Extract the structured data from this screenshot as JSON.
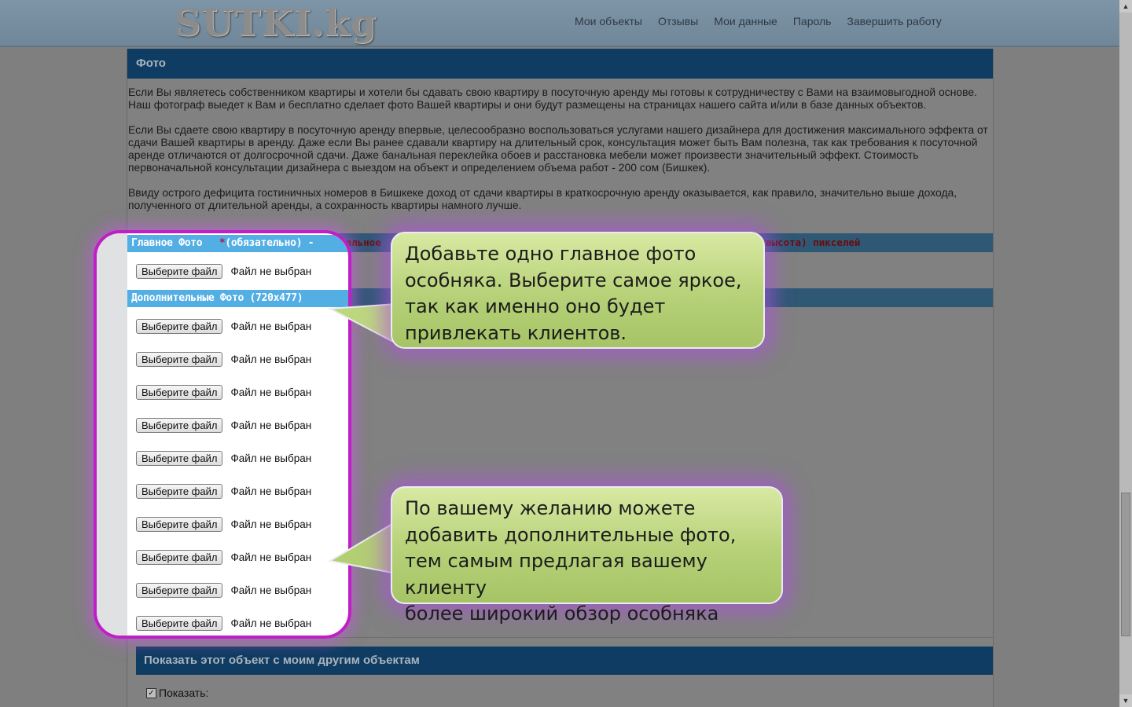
{
  "site": {
    "logo": "SUTKI.kg"
  },
  "nav": [
    "Мои объекты",
    "Отзывы",
    "Мои данные",
    "Пароль",
    "Завершить работу"
  ],
  "section": {
    "title": "Фото",
    "paragraphs": [
      "Если Вы являетесь собственником квартиры и хотели бы сдавать свою квартиру в посуточную аренду мы готовы к сотрудничеству с Вами на взаимовыгодной основе. Наш фотограф выедет к Вам и бесплатно сделает фото Вашей квартиры и они будут размещены на страницах нашего сайта и/или в базе данных объектов.",
      "Если Вы сдаете свою квартиру в посуточную аренду впервые, целесообразно воспользоваться услугами нашего дизайнера для достижения максимального эффекта от сдачи Вашей квартиры в аренду. Даже если Вы ранее сдавали квартиру на длительный срок, консультация может быть Вам полезна, так как требования к посуточной аренде отличаются от долгосрочной сдачи. Даже банальная переклейка обоев и расстановка мебели может произвести значительный эффект. Стоимость первоначальной консультации дизайнера с выездом на объект и определением объема работ - 200 сом (Бишкек).",
      "Ввиду острого дефицита гостиничных номеров в Бишкеке доход от сдачи квартиры в краткосрочную аренду оказывается, как правило, значительно выше дохода, полученного от длительной аренды, а сохранность квартиры намного лучше."
    ],
    "main_strip_left": "Минимальное",
    "main_strip_right": "высота) пикселей"
  },
  "photos": {
    "main_label": "Главное Фото",
    "required_mark": "*",
    "required_text": "(обязательно)",
    "required_dash": " - ",
    "extra_label": "Дополнительные Фото (720х477)",
    "button_label": "Выберите файл",
    "status": "Файл не выбран",
    "extra_count": 10
  },
  "callouts": {
    "main": "Добавьте одно главное фото\nособняка. Выберите самое яркое,\nтак как именно оно будет\nпривлекать клиентов.",
    "extra": "По вашему желанию можете\nдобавить дополнительные фото,\nтем самым предлагая вашему клиенту\nболее широкий обзор особняка"
  },
  "show": {
    "title": "Показать этот объект с моим другим объектам",
    "checkbox_label": "Показать:",
    "checked": true
  },
  "colors": {
    "accent": "#c01ec6",
    "header": "#53aee4",
    "callout": "#b6d178"
  }
}
